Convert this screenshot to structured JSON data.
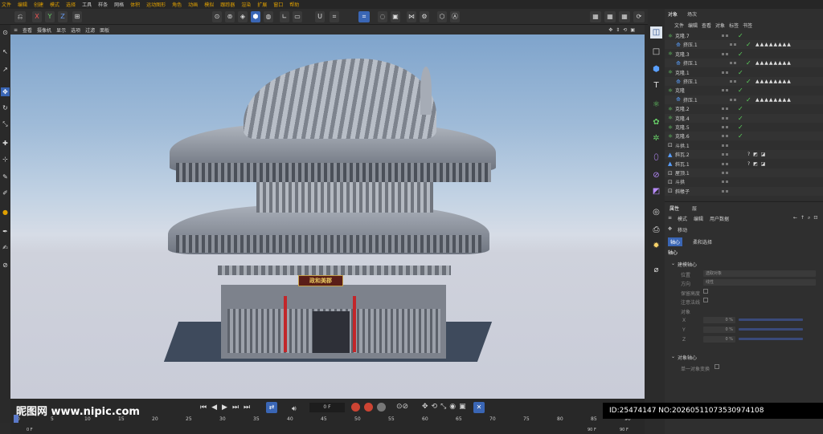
{
  "menubar": [
    "文件",
    "编辑",
    "创建",
    "模式",
    "选择",
    "工具",
    "样条",
    "网格",
    "体积",
    "运动图形",
    "角色",
    "动画",
    "模拟",
    "跟踪器",
    "渲染",
    "扩展",
    "窗口",
    "帮助"
  ],
  "toolbar": {
    "axes": [
      "X",
      "Y",
      "Z"
    ],
    "buttons": [
      "undo",
      "redo",
      "move",
      "scale",
      "rotate",
      "cube",
      "pen",
      "subdivide",
      "extrude",
      "light",
      "camera"
    ]
  },
  "viewport_menu": [
    "查看",
    "摄像机",
    "显示",
    "选项",
    "过滤",
    "面板"
  ],
  "object_tabs": [
    "对象",
    "场次"
  ],
  "object_menu": [
    "文件",
    "编辑",
    "查看",
    "对象",
    "标签",
    "书签"
  ],
  "objects": [
    {
      "name": "克隆.7",
      "type": "cloner",
      "check": true,
      "tags": ""
    },
    {
      "name": "挤压.1",
      "type": "extrude",
      "check": true,
      "tags": "▲▲▲▲▲▲▲▲"
    },
    {
      "name": "克隆.3",
      "type": "cloner",
      "check": true,
      "tags": ""
    },
    {
      "name": "挤压.1",
      "type": "extrude",
      "check": true,
      "tags": "▲▲▲▲▲▲▲▲"
    },
    {
      "name": "克隆.1",
      "type": "cloner",
      "check": true,
      "tags": ""
    },
    {
      "name": "挤压.1",
      "type": "extrude",
      "check": true,
      "tags": "▲▲▲▲▲▲▲▲"
    },
    {
      "name": "克隆",
      "type": "cloner",
      "check": true,
      "tags": ""
    },
    {
      "name": "挤压.1",
      "type": "extrude",
      "check": true,
      "tags": "▲▲▲▲▲▲▲▲"
    },
    {
      "name": "克隆.2",
      "type": "cloner",
      "check": true,
      "tags": ""
    },
    {
      "name": "克隆.4",
      "type": "cloner",
      "check": true,
      "tags": ""
    },
    {
      "name": "克隆.5",
      "type": "cloner",
      "check": true,
      "tags": ""
    },
    {
      "name": "克隆.6",
      "type": "cloner",
      "check": true,
      "tags": ""
    },
    {
      "name": "斗拱.1",
      "type": "null",
      "check": false,
      "tags": ""
    },
    {
      "name": "斜瓦.2",
      "type": "poly",
      "check": false,
      "tags": "? ◩ ◪"
    },
    {
      "name": "斜瓦.1",
      "type": "poly",
      "check": false,
      "tags": "? ◩ ◪"
    },
    {
      "name": "屋顶.1",
      "type": "null",
      "check": false,
      "tags": ""
    },
    {
      "name": "斗拱",
      "type": "null",
      "check": false,
      "tags": ""
    },
    {
      "name": "斜椽子",
      "type": "null",
      "check": false,
      "tags": ""
    }
  ],
  "attr_tabs": [
    "属性",
    "层"
  ],
  "attr_menu": [
    "模式",
    "编辑",
    "用户数据"
  ],
  "attr_title": "移动",
  "attr_subtabs": [
    "轴心",
    "柔和选择"
  ],
  "attr_section": "轴心",
  "attr_group1": "建模轴心",
  "attr_pos_label": "位置",
  "attr_pos_value": "选取对象",
  "attr_dir_label": "方向",
  "attr_dir_value": "线性",
  "attr_keep_label": "保留高度",
  "attr_orient_label": "注意法线",
  "attr_object_label": "对象",
  "attr_x": "0 %",
  "attr_y": "0 %",
  "attr_z": "0 %",
  "attr_xl": "X",
  "attr_yl": "Y",
  "attr_zl": "Z",
  "attr_group2": "对象轴心",
  "attr_single": "单一对象变换",
  "timeline": {
    "frame": "0 F",
    "ticks": [
      "0",
      "5",
      "10",
      "15",
      "20",
      "25",
      "30",
      "35",
      "40",
      "45",
      "50",
      "55",
      "60",
      "65",
      "70",
      "75",
      "80",
      "85",
      "90"
    ],
    "start": "0 F",
    "end_a": "90 F",
    "end_b": "90 F"
  },
  "signboard": "政和美郡",
  "watermark_site": "昵图网 www.nipic.com",
  "watermark_id": "ID:25474147 NO:20260511073530974108"
}
